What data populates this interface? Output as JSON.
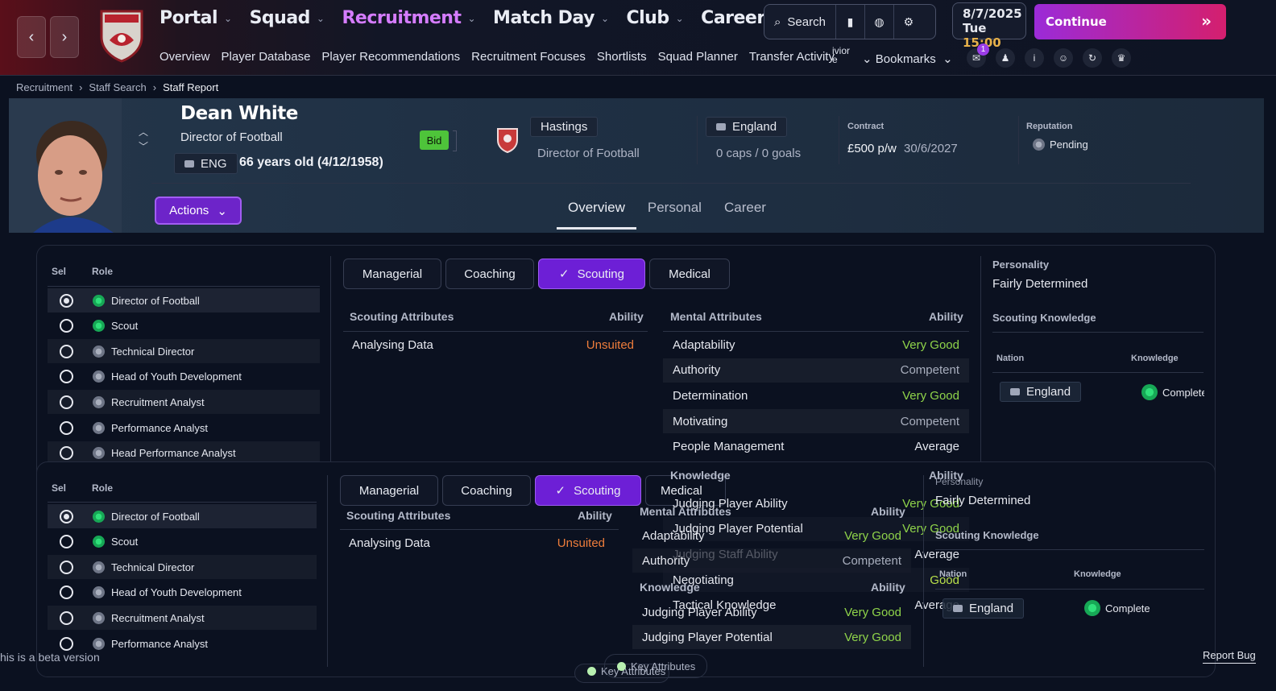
{
  "nav": {
    "main": [
      {
        "label": "Portal",
        "active": false
      },
      {
        "label": "Squad",
        "active": false
      },
      {
        "label": "Recruitment",
        "active": true
      },
      {
        "label": "Match Day",
        "active": false
      },
      {
        "label": "Club",
        "active": false
      },
      {
        "label": "Career",
        "active": false
      }
    ],
    "sub": [
      "Overview",
      "Player Database",
      "Player Recommendations",
      "Recruitment Focuses",
      "Shortlists",
      "Squad Planner",
      "Transfer Activity"
    ],
    "sub_overflow": "ivior\ne",
    "bookmarks": "Bookmarks",
    "club_crest_text": "MORECAMBE FC"
  },
  "search": {
    "label": "Search"
  },
  "date": {
    "date": "8/7/2025",
    "day": "Tue",
    "time": "15:00"
  },
  "continue_label": "Continue",
  "notifications_count": "1",
  "breadcrumb": [
    "Recruitment",
    "Staff Search",
    "Staff Report"
  ],
  "staff": {
    "name": "Dean White",
    "role": "Director of Football",
    "nation_code": "ENG",
    "age": "66 years old (4/12/1958)",
    "bid": "Bid",
    "club": "Hastings",
    "club_role": "Director of Football",
    "nation": "England",
    "caps": "0 caps / 0 goals",
    "contract_label": "Contract",
    "wage": "£500 p/w",
    "contract_end": "30/6/2027",
    "reputation_label": "Reputation",
    "reputation": "Pending"
  },
  "actions_label": "Actions",
  "profile_tabs": [
    "Overview",
    "Personal",
    "Career"
  ],
  "roles_table": {
    "col_sel": "Sel",
    "col_role": "Role",
    "roles": [
      {
        "name": "Director of Football",
        "selected": true,
        "green": true
      },
      {
        "name": "Scout",
        "selected": false,
        "green": true
      },
      {
        "name": "Technical Director",
        "selected": false,
        "green": false
      },
      {
        "name": "Head of Youth Development",
        "selected": false,
        "green": false
      },
      {
        "name": "Recruitment Analyst",
        "selected": false,
        "green": false
      },
      {
        "name": "Performance Analyst",
        "selected": false,
        "green": false
      },
      {
        "name": "Head Performance Analyst",
        "selected": false,
        "green": false
      }
    ]
  },
  "category_tabs": [
    "Managerial",
    "Coaching",
    "Scouting",
    "Medical"
  ],
  "scouting": {
    "header": "Scouting Attributes",
    "ability": "Ability",
    "rows": [
      {
        "name": "Analysing Data",
        "value": "Unsuited"
      }
    ]
  },
  "mental": {
    "header": "Mental Attributes",
    "ability": "Ability",
    "rows": [
      {
        "name": "Adaptability",
        "value": "Very Good"
      },
      {
        "name": "Authority",
        "value": "Competent"
      },
      {
        "name": "Determination",
        "value": "Very Good"
      },
      {
        "name": "Motivating",
        "value": "Competent"
      },
      {
        "name": "People Management",
        "value": "Average"
      }
    ]
  },
  "knowledge": {
    "header": "Knowledge",
    "ability": "Ability",
    "rows": [
      {
        "name": "Judging Player Ability",
        "value": "Very Good"
      },
      {
        "name": "Judging Player Potential",
        "value": "Very Good"
      },
      {
        "name": "Judging Staff Ability",
        "value": "Average"
      },
      {
        "name": "Negotiating",
        "value": "Good"
      },
      {
        "name": "Tactical Knowledge",
        "value": "Average"
      }
    ]
  },
  "personality": {
    "label": "Personality",
    "value": "Fairly Determined"
  },
  "scouting_knowledge": {
    "label": "Scouting Knowledge",
    "col_nation": "Nation",
    "col_knowledge": "Knowledge",
    "nation": "England",
    "knowledge": "Complete"
  },
  "footer": {
    "beta": "his is a beta version",
    "key_attributes": "Key Attributes",
    "report_bug": "Report Bug"
  },
  "colors": {
    "accent": "#6d1fd6",
    "active_nav": "#d57cff",
    "very_good": "#8fd44a",
    "unsuited": "#ee7d3b"
  }
}
